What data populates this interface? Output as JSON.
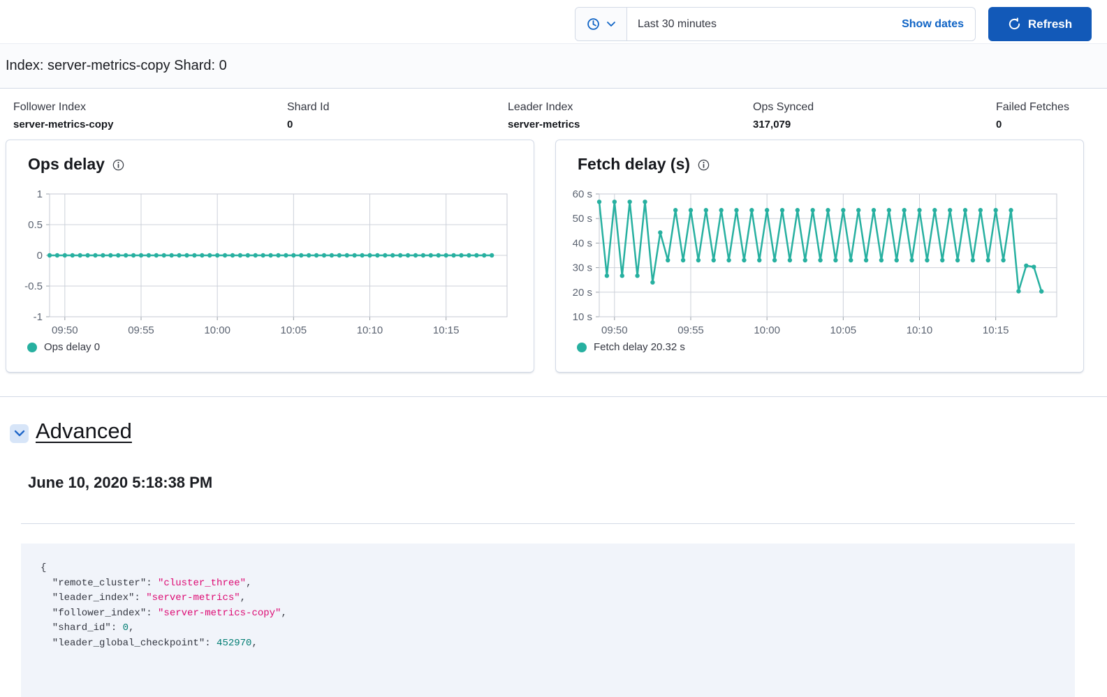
{
  "colors": {
    "primary_button": "#1259b8",
    "link": "#0e63c5",
    "series_teal": "#27b0a0",
    "code_string": "#dd0a73",
    "code_number": "#017d73",
    "panel_border": "#d3dae6",
    "grid": "#ccd0d9"
  },
  "icons": {
    "time_quick_select": "clock-icon",
    "time_quick_caret": "chevron-down-icon",
    "refresh": "refresh-icon",
    "chart_info": "info-icon",
    "advanced_toggle": "chevron-down-icon"
  },
  "time_picker": {
    "selected": "Last 30 minutes",
    "show_dates_label": "Show dates",
    "refresh_label": "Refresh"
  },
  "page": {
    "title": "Index: server-metrics-copy Shard: 0"
  },
  "stats": [
    {
      "label": "Follower Index",
      "value": "server-metrics-copy"
    },
    {
      "label": "Shard Id",
      "value": "0"
    },
    {
      "label": "Leader Index",
      "value": "server-metrics"
    },
    {
      "label": "Ops Synced",
      "value": "317,079"
    },
    {
      "label": "Failed Fetches",
      "value": "0"
    }
  ],
  "chart_data": [
    {
      "type": "line",
      "title": "Ops delay",
      "legend": "Ops delay 0",
      "color": "#27b0a0",
      "x_start": "09:49:00",
      "x_step_seconds": 30,
      "x_range_minutes": [
        0,
        30
      ],
      "x_ticks": [
        "09:50",
        "09:55",
        "10:00",
        "10:05",
        "10:10",
        "10:15"
      ],
      "x_tick_minutes": [
        1,
        6,
        11,
        16,
        21,
        26
      ],
      "ylim": [
        -1,
        1
      ],
      "y_tick_values": [
        1,
        0.5,
        0,
        -0.5,
        -1
      ],
      "y_tick_labels": [
        "1",
        "0.5",
        "0",
        "-0.5",
        "-1"
      ],
      "grid": true,
      "legend_position": "bottom",
      "values": [
        0,
        0,
        0,
        0,
        0,
        0,
        0,
        0,
        0,
        0,
        0,
        0,
        0,
        0,
        0,
        0,
        0,
        0,
        0,
        0,
        0,
        0,
        0,
        0,
        0,
        0,
        0,
        0,
        0,
        0,
        0,
        0,
        0,
        0,
        0,
        0,
        0,
        0,
        0,
        0,
        0,
        0,
        0,
        0,
        0,
        0,
        0,
        0,
        0,
        0,
        0,
        0,
        0,
        0,
        0,
        0,
        0,
        0,
        0
      ]
    },
    {
      "type": "line",
      "title": "Fetch delay (s)",
      "legend": "Fetch delay 20.32 s",
      "color": "#27b0a0",
      "x_start": "09:49:00",
      "x_step_seconds": 30,
      "x_range_minutes": [
        0,
        30
      ],
      "x_ticks": [
        "09:50",
        "09:55",
        "10:00",
        "10:05",
        "10:10",
        "10:15"
      ],
      "x_tick_minutes": [
        1,
        6,
        11,
        16,
        21,
        26
      ],
      "ylim": [
        10,
        60
      ],
      "y_tick_values": [
        60,
        50,
        40,
        30,
        20,
        10
      ],
      "y_tick_labels": [
        "60 s",
        "50 s",
        "40 s",
        "30 s",
        "20 s",
        "10 s"
      ],
      "grid": true,
      "legend_position": "bottom",
      "values": [
        56.8,
        26.7,
        56.8,
        26.7,
        56.8,
        26.7,
        56.8,
        24,
        44.3,
        33,
        53.4,
        33,
        53.4,
        33,
        53.4,
        33,
        53.4,
        33,
        53.4,
        33,
        53.4,
        33,
        53.4,
        33,
        53.4,
        33,
        53.4,
        33,
        53.4,
        33,
        53.4,
        33,
        53.4,
        33,
        53.4,
        33,
        53.4,
        33,
        53.4,
        33,
        53.4,
        33,
        53.4,
        33,
        53.4,
        33,
        53.4,
        33,
        53.4,
        33,
        53.4,
        33,
        53.4,
        33,
        53.4,
        20.4,
        30.8,
        30.3,
        20.32
      ]
    }
  ],
  "advanced": {
    "label": "Advanced",
    "timestamp": "June 10, 2020 5:18:38 PM"
  },
  "code_block": {
    "lines": [
      [
        [
          "p",
          "{"
        ]
      ],
      [
        [
          "p",
          "  \"remote_cluster\": "
        ],
        [
          "s",
          "\"cluster_three\""
        ],
        [
          "p",
          ","
        ]
      ],
      [
        [
          "p",
          "  \"leader_index\": "
        ],
        [
          "s",
          "\"server-metrics\""
        ],
        [
          "p",
          ","
        ]
      ],
      [
        [
          "p",
          "  \"follower_index\": "
        ],
        [
          "s",
          "\"server-metrics-copy\""
        ],
        [
          "p",
          ","
        ]
      ],
      [
        [
          "p",
          "  \"shard_id\": "
        ],
        [
          "n",
          "0"
        ],
        [
          "p",
          ","
        ]
      ],
      [
        [
          "p",
          "  \"leader_global_checkpoint\": "
        ],
        [
          "n",
          "452970"
        ],
        [
          "p",
          ","
        ]
      ]
    ]
  }
}
